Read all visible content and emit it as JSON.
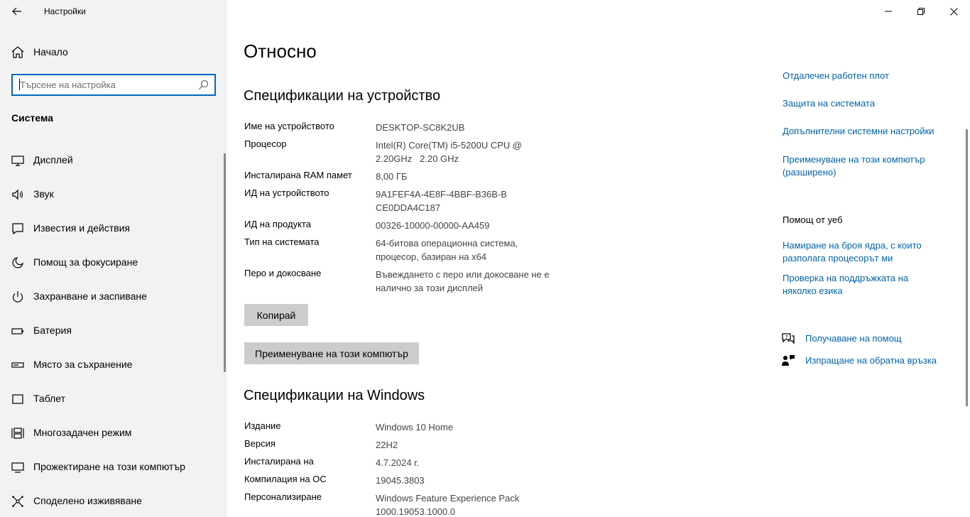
{
  "window": {
    "title": "Настройки",
    "controls": {
      "minimize": "minimize-icon",
      "restore": "restore-icon",
      "close": "close-icon"
    }
  },
  "sidebar": {
    "home_label": "Начало",
    "search_placeholder": "Търсене на настройка",
    "section_title": "Система",
    "items": [
      {
        "label": "Дисплей",
        "icon": "display-icon"
      },
      {
        "label": "Звук",
        "icon": "speaker-icon"
      },
      {
        "label": "Известия и действия",
        "icon": "notification-icon"
      },
      {
        "label": "Помощ за фокусиране",
        "icon": "moon-icon"
      },
      {
        "label": "Захранване и заспиване",
        "icon": "power-icon"
      },
      {
        "label": "Батерия",
        "icon": "battery-icon"
      },
      {
        "label": "Място за съхранение",
        "icon": "storage-icon"
      },
      {
        "label": "Таблет",
        "icon": "tablet-icon"
      },
      {
        "label": "Многозадачен режим",
        "icon": "multitask-icon"
      },
      {
        "label": "Прожектиране на този компютър",
        "icon": "project-icon"
      },
      {
        "label": "Споделено изживяване",
        "icon": "shared-icon"
      }
    ]
  },
  "main": {
    "page_title": "Относно",
    "device_specs": {
      "title": "Спецификации на устройство",
      "rows": [
        {
          "key": "Име на устройството",
          "value": "DESKTOP-SC8K2UB"
        },
        {
          "key": "Процесор",
          "value": "Intel(R) Core(TM) i5-5200U CPU @ 2.20GHz   2.20 GHz"
        },
        {
          "key": "Инсталирана RAM памет",
          "value": "8,00 ГБ"
        },
        {
          "key": "ИД на устройството",
          "value": "9A1FEF4A-4E8F-4BBF-B36B-BCE0DDA4C187"
        },
        {
          "key": "ИД на продукта",
          "value": "00326-10000-00000-AA459"
        },
        {
          "key": "Тип на системата",
          "value": "64-битова операционна система, процесор, базиран на x64"
        },
        {
          "key": "Перо и докосване",
          "value": "Въвеждането с перо или докосване не е налично за този дисплей"
        }
      ],
      "copy_button": "Копирай",
      "rename_button": "Преименуване на този компютър"
    },
    "windows_specs": {
      "title": "Спецификации на Windows",
      "rows": [
        {
          "key": "Издание",
          "value": "Windows 10 Home"
        },
        {
          "key": "Версия",
          "value": "22H2"
        },
        {
          "key": "Инсталирана на",
          "value": "4.7.2024 г."
        },
        {
          "key": "Компилация на ОС",
          "value": "19045.3803"
        },
        {
          "key": "Персонализиране",
          "value": "Windows Feature Experience Pack 1000.19053.1000.0"
        }
      ]
    }
  },
  "related": {
    "links": [
      "Отдалечен работен плот",
      "Защита на системата",
      "Допълнителни системни настройки",
      "Преименуване на този компютър (разширено)"
    ],
    "web_help_title": "Помощ от уеб",
    "web_help_links": [
      "Намиране на броя ядра, с които разполага процесорът ми",
      "Проверка на поддръжката на няколко езика"
    ],
    "get_help": "Получаване на помощ",
    "feedback": "Изпращане на обратна връзка"
  }
}
